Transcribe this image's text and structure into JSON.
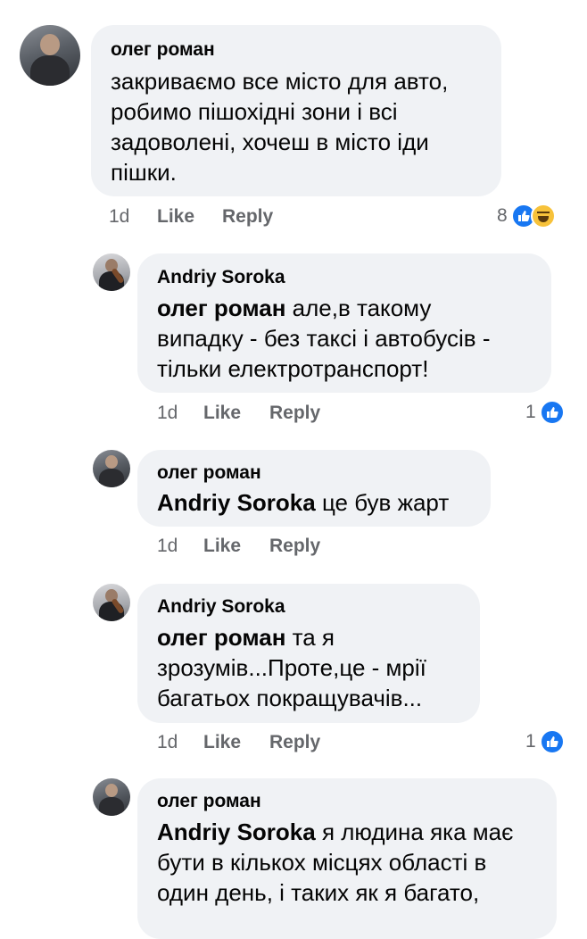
{
  "comments": [
    {
      "author": "олег роман",
      "mention": "",
      "lines": [
        "закриваємо все місто для авто,",
        "робимо пішохідні зони і всі",
        "задоволені,  хочеш в місто іди",
        "пішки."
      ],
      "time": "1d",
      "like": "Like",
      "reply": "Reply",
      "reaction_count": "8",
      "reactions": [
        "like-icon",
        "haha-icon"
      ]
    },
    {
      "author": "Andriy Soroka",
      "mention": "олег роман",
      "lines": [
        " але,в такому",
        "випадку - без таксі і автобусів -",
        "тільки електротранспорт!"
      ],
      "time": "1d",
      "like": "Like",
      "reply": "Reply",
      "reaction_count": "1",
      "reactions": [
        "like-icon"
      ]
    },
    {
      "author": "олег роман",
      "mention": "Andriy Soroka",
      "lines": [
        " це був жарт"
      ],
      "time": "1d",
      "like": "Like",
      "reply": "Reply",
      "reaction_count": "",
      "reactions": []
    },
    {
      "author": "Andriy Soroka",
      "mention": "олег роман",
      "lines": [
        " та я",
        "зрозумів...Проте,це - мрії",
        "багатьох покращувачів..."
      ],
      "time": "1d",
      "like": "Like",
      "reply": "Reply",
      "reaction_count": "1",
      "reactions": [
        "like-icon"
      ]
    },
    {
      "author": "олег роман",
      "mention": "Andriy Soroka",
      "lines": [
        " я людина яка має",
        "бути в кількох місцях області в",
        "один день,  і таких як я багато,"
      ],
      "time": "",
      "like": "",
      "reply": "",
      "reaction_count": "",
      "reactions": []
    }
  ],
  "colors": {
    "bubble": "#f0f2f5",
    "meta_text": "#65676b",
    "like_blue": "#1877f2",
    "haha_yellow": "#f7c23a"
  }
}
